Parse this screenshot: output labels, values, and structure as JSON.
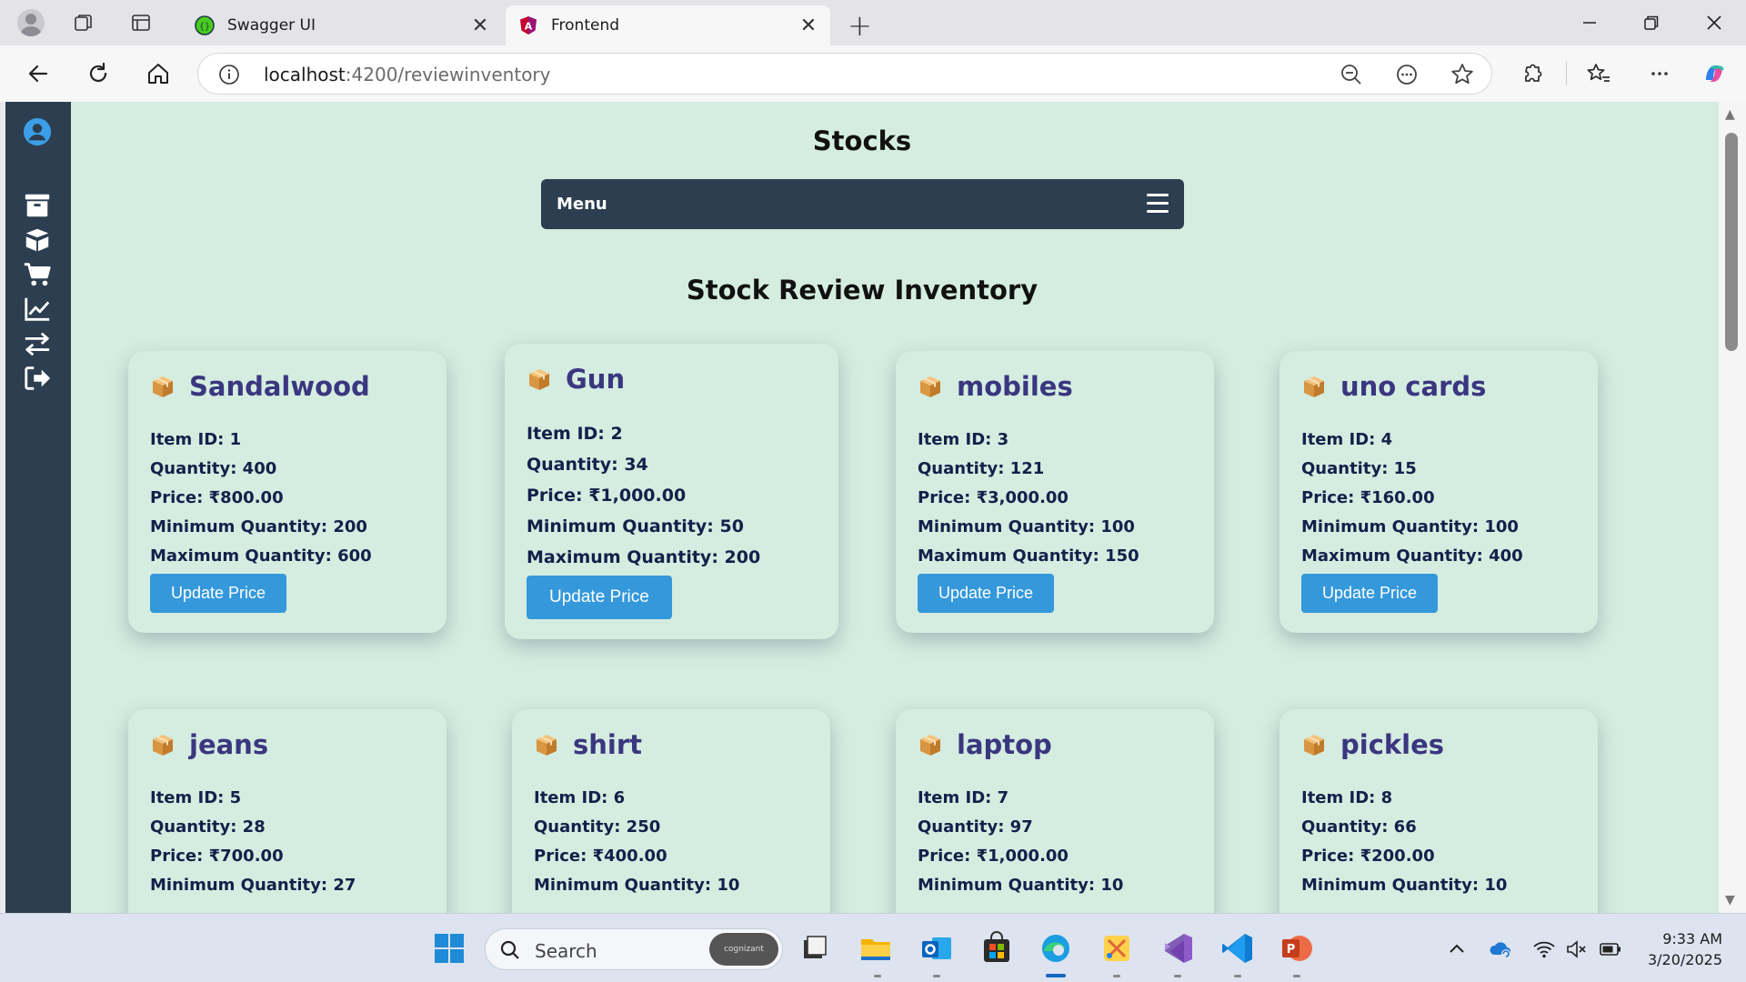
{
  "browser": {
    "tabs": [
      {
        "title": "Swagger UI",
        "favicon": "swagger-icon"
      },
      {
        "title": "Frontend",
        "favicon": "angular-icon",
        "active": true
      }
    ],
    "address": {
      "host": "localhost",
      "path": ":4200/reviewinventory"
    }
  },
  "sidebar": {
    "icons": [
      "user-circle-icon",
      "archive-icon",
      "box-open-icon",
      "cart-icon",
      "chart-line-icon",
      "exchange-icon",
      "logout-icon"
    ],
    "color": "#2c3e50"
  },
  "page": {
    "title": "Stocks",
    "menu_label": "Menu",
    "section_title": "Stock Review Inventory",
    "accent": "#3498db",
    "card_title_color": "#3b3680"
  },
  "labels": {
    "item_id": "Item ID:",
    "quantity": "Quantity:",
    "price": "Price:",
    "min_qty": "Minimum Quantity:",
    "max_qty": "Maximum Quantity:",
    "update_price": "Update Price"
  },
  "items": [
    {
      "name": "Sandalwood",
      "id": "1",
      "quantity": "400",
      "price": "₹800.00",
      "min": "200",
      "max": "600"
    },
    {
      "name": "Gun",
      "id": "2",
      "quantity": "34",
      "price": "₹1,000.00",
      "min": "50",
      "max": "200"
    },
    {
      "name": "mobiles",
      "id": "3",
      "quantity": "121",
      "price": "₹3,000.00",
      "min": "100",
      "max": "150"
    },
    {
      "name": "uno cards",
      "id": "4",
      "quantity": "15",
      "price": "₹160.00",
      "min": "100",
      "max": "400"
    },
    {
      "name": "jeans",
      "id": "5",
      "quantity": "28",
      "price": "₹700.00",
      "min": "27"
    },
    {
      "name": "shirt",
      "id": "6",
      "quantity": "250",
      "price": "₹400.00",
      "min": "10"
    },
    {
      "name": "laptop",
      "id": "7",
      "quantity": "97",
      "price": "₹1,000.00",
      "min": "10"
    },
    {
      "name": "pickles",
      "id": "8",
      "quantity": "66",
      "price": "₹200.00",
      "min": "10"
    }
  ],
  "taskbar": {
    "search_placeholder": "Search",
    "search_badge": "cognizant",
    "apps": [
      "windows-start-icon",
      "task-view-icon",
      "file-explorer-icon",
      "outlook-icon",
      "microsoft-store-icon",
      "edge-icon",
      "snipping-tool-icon",
      "visual-studio-icon",
      "vscode-icon",
      "powerpoint-icon"
    ],
    "time": "9:33 AM",
    "date": "3/20/2025"
  }
}
